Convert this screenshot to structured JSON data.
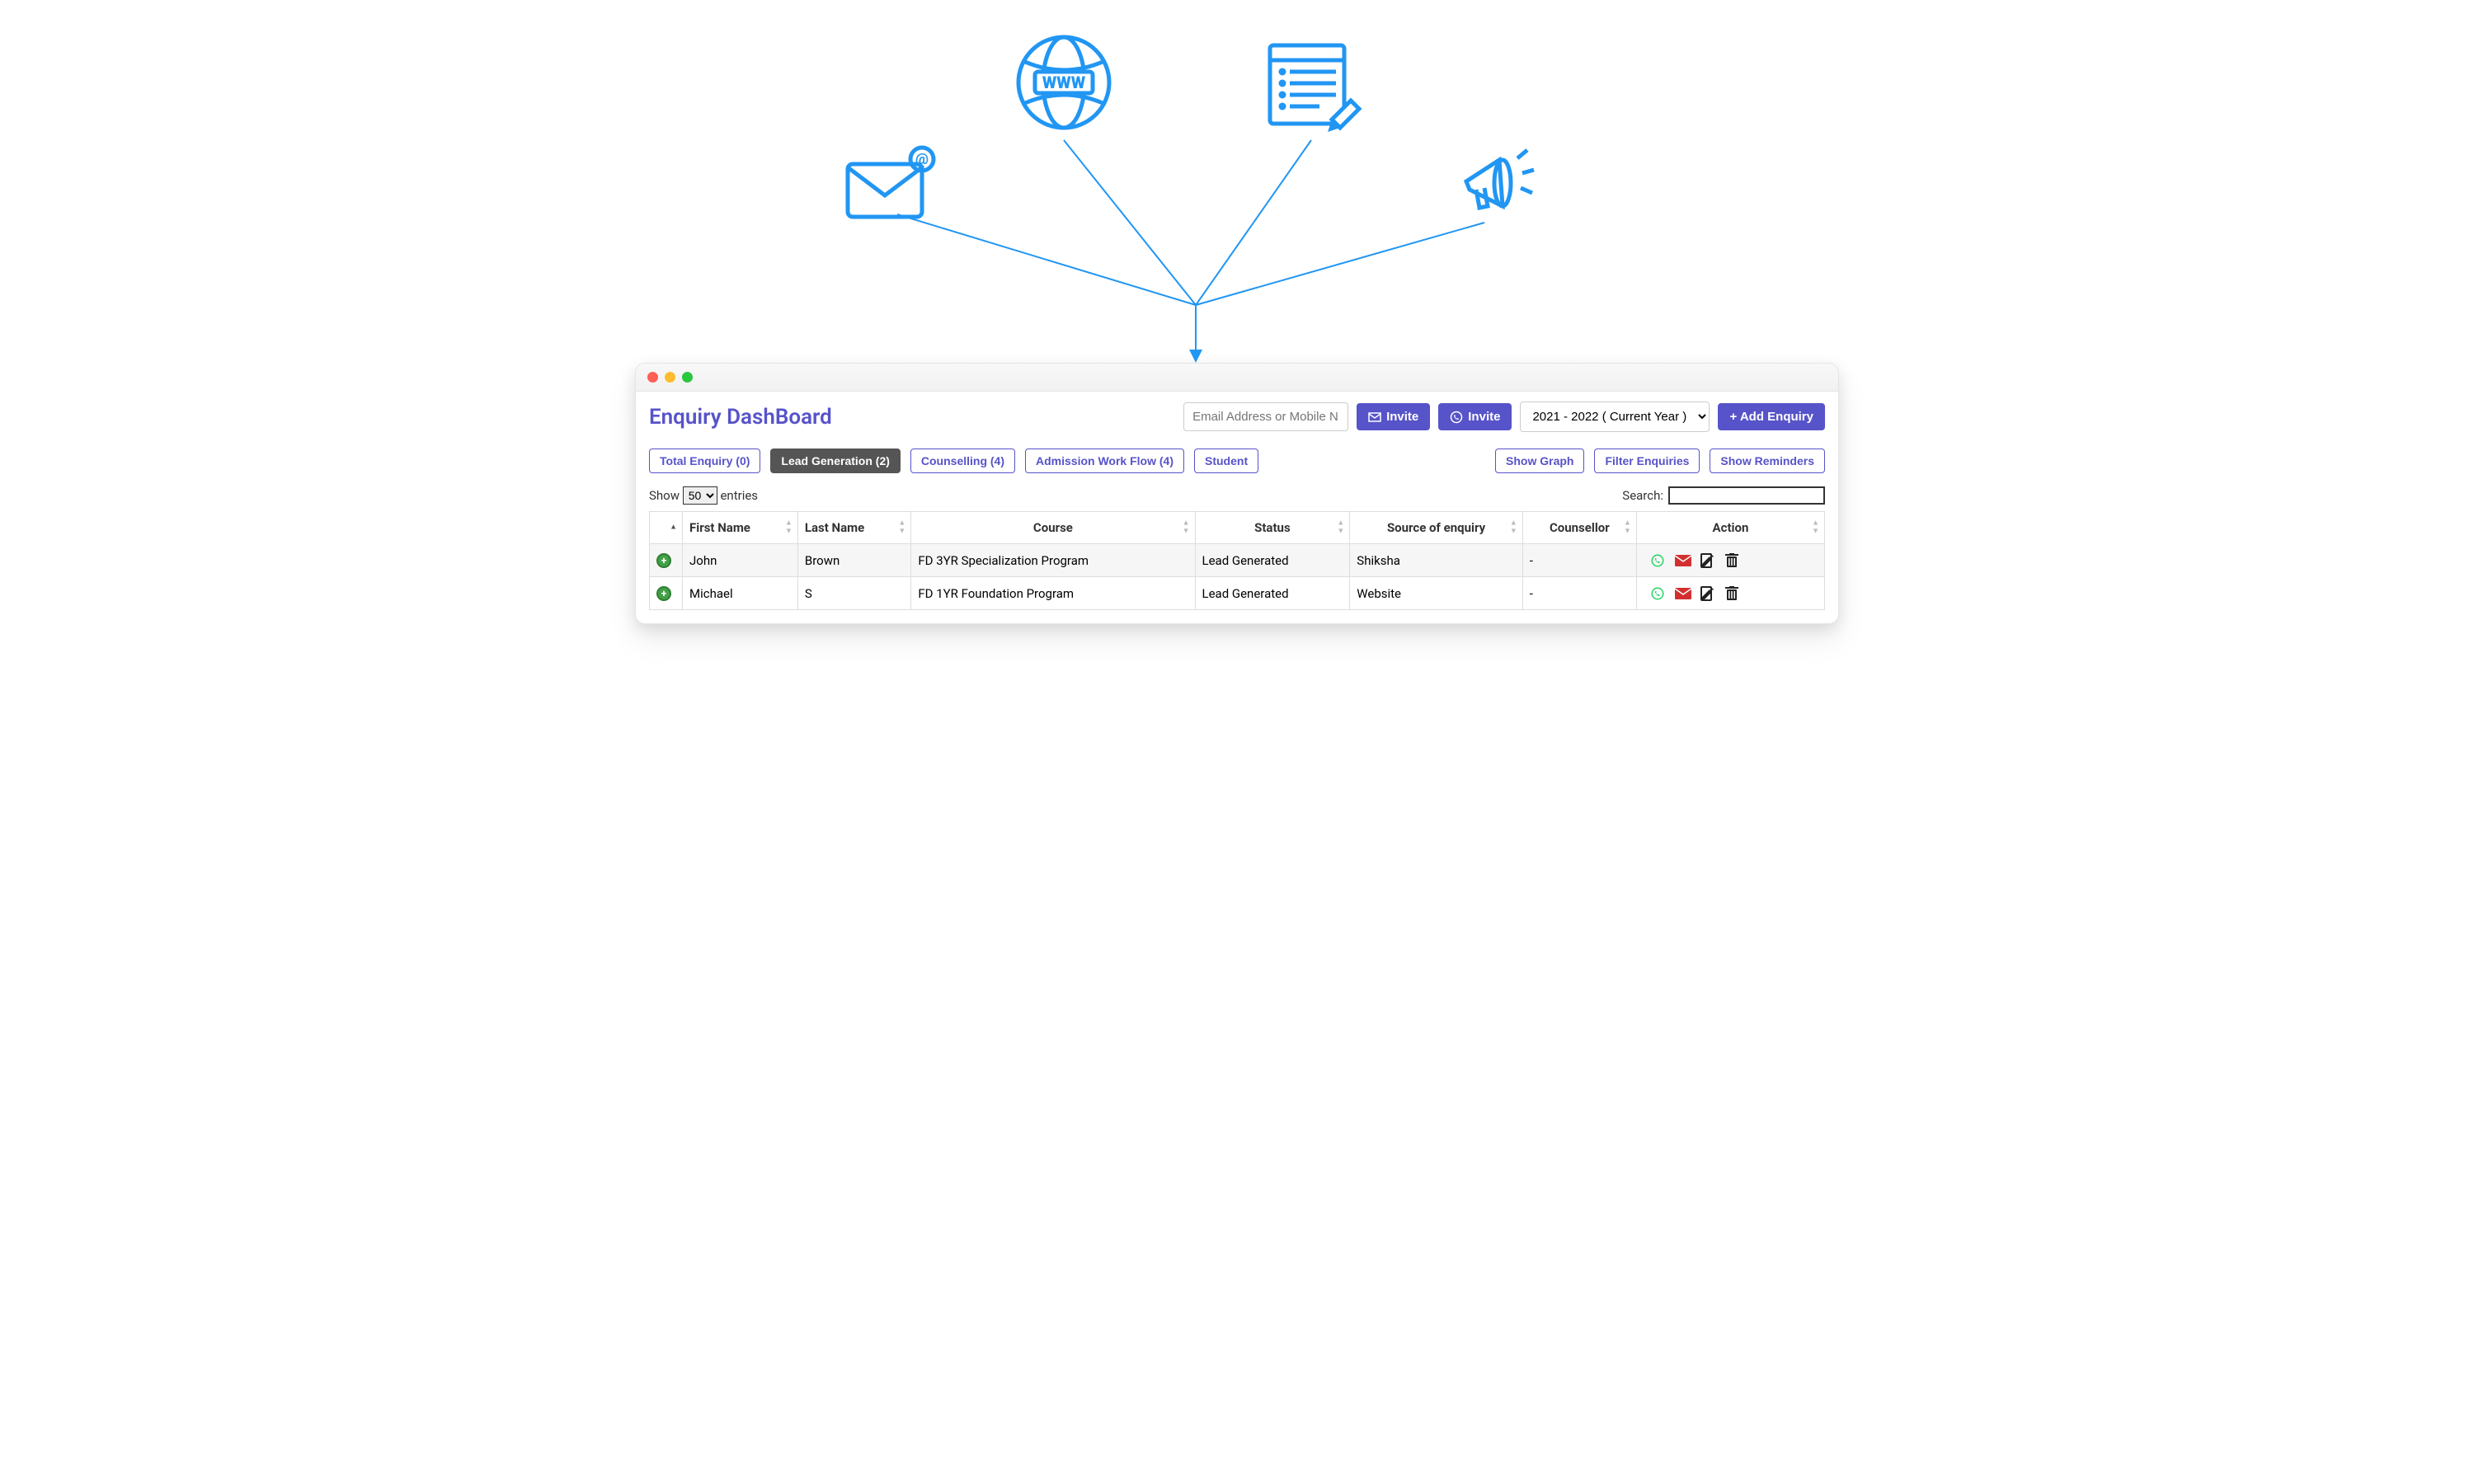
{
  "page_title": "Enquiry DashBoard",
  "header": {
    "search_placeholder": "Email Address or Mobile N",
    "invite_email_label": "Invite",
    "invite_whatsapp_label": "Invite",
    "year_select": "2021 - 2022 ( Current Year )",
    "add_enquiry_label": "+ Add Enquiry"
  },
  "tabs": {
    "left": [
      {
        "label": "Total Enquiry (0)",
        "active": false
      },
      {
        "label": "Lead Generation (2)",
        "active": true
      },
      {
        "label": "Counselling (4)",
        "active": false
      },
      {
        "label": "Admission Work Flow (4)",
        "active": false
      },
      {
        "label": "Student",
        "active": false
      }
    ],
    "right": [
      {
        "label": "Show Graph"
      },
      {
        "label": "Filter Enquiries"
      },
      {
        "label": "Show Reminders"
      }
    ]
  },
  "table_controls": {
    "show_prefix": "Show",
    "page_size": "50",
    "show_suffix": "entries",
    "search_label": "Search:"
  },
  "columns": [
    "",
    "First Name",
    "Last Name",
    "Course",
    "Status",
    "Source of enquiry",
    "Counsellor",
    "Action"
  ],
  "rows": [
    {
      "first": "John",
      "last": "Brown",
      "course": "FD 3YR Specialization Program",
      "status": "Lead Generated",
      "source": "Shiksha",
      "counsellor": "-"
    },
    {
      "first": "Michael",
      "last": "S",
      "course": "FD 1YR Foundation Program",
      "status": "Lead Generated",
      "source": "Website",
      "counsellor": "-"
    }
  ],
  "funnel_icons": [
    "email-icon",
    "globe-www-icon",
    "notepad-icon",
    "megaphone-icon"
  ]
}
